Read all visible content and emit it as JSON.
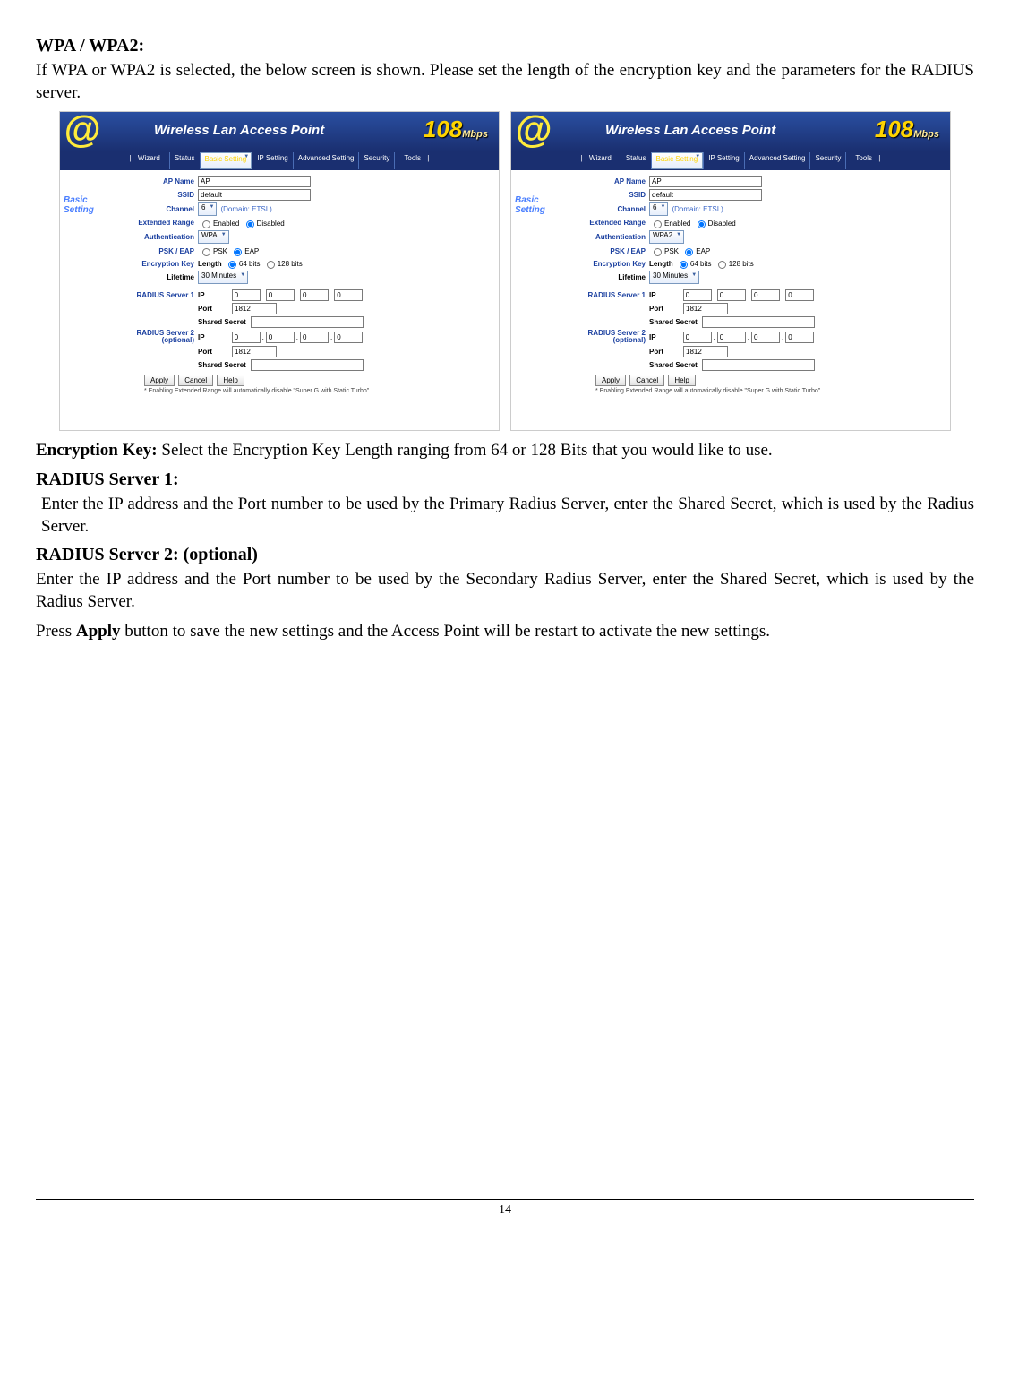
{
  "headings": {
    "wpa": "WPA / WPA2:",
    "enc": "Encryption Key:",
    "r1": "RADIUS Server 1:",
    "r2": "RADIUS Server 2: (optional)"
  },
  "paras": {
    "intro": "If WPA or WPA2 is selected, the below screen is shown.  Please set the length of the encryption key and the parameters for the RADIUS server.",
    "enc": " Select the Encryption Key Length ranging from 64 or 128 Bits that you would like to use.",
    "r1": "Enter the IP address and the Port number to be used by the Primary Radius Server, enter the Shared Secret, which is used by the Radius Server.",
    "r2": "Enter the IP address and the Port number to be used by the Secondary Radius Server, enter the Shared Secret, which is used by the Radius Server.",
    "apply_pre": "Press ",
    "apply_bold": "Apply",
    "apply_post": " button to save the new settings and the Access Point will be restart to activate the new settings."
  },
  "screenshot": {
    "banner_title": "Wireless Lan Access Point",
    "mbps": "108",
    "mbps_unit": "Mbps",
    "tabs": [
      "Wizard",
      "Status",
      "Basic Setting",
      "IP Setting",
      "Advanced Setting",
      "Security",
      "Tools"
    ],
    "side": "Basic Setting",
    "labels": {
      "apname": "AP Name",
      "ssid": "SSID",
      "channel": "Channel",
      "domain": "(Domain: ETSI )",
      "extrange": "Extended Range",
      "enabled": "Enabled",
      "disabled": "Disabled",
      "auth": "Authentication",
      "pskeap": "PSK / EAP",
      "psk": "PSK",
      "eap": "EAP",
      "enckey": "Encryption Key",
      "length": "Length",
      "b64": "64 bits",
      "b128": "128 bits",
      "lifetime": "Lifetime",
      "lifeval": "30 Minutes",
      "rs1": "RADIUS Server 1",
      "rs2": "RADIUS Server 2 (optional)",
      "ip": "IP",
      "port": "Port",
      "secret": "Shared Secret"
    },
    "values": {
      "apname": "AP",
      "ssid": "default",
      "channel": "6",
      "auth_left": "WPA",
      "auth_right": "WPA2",
      "ip": "0",
      "port": "1812"
    },
    "buttons": {
      "apply": "Apply",
      "cancel": "Cancel",
      "help": "Help"
    },
    "note": "* Enabling Extended Range will automatically disable \"Super G with Static Turbo\""
  },
  "page_number": "14"
}
